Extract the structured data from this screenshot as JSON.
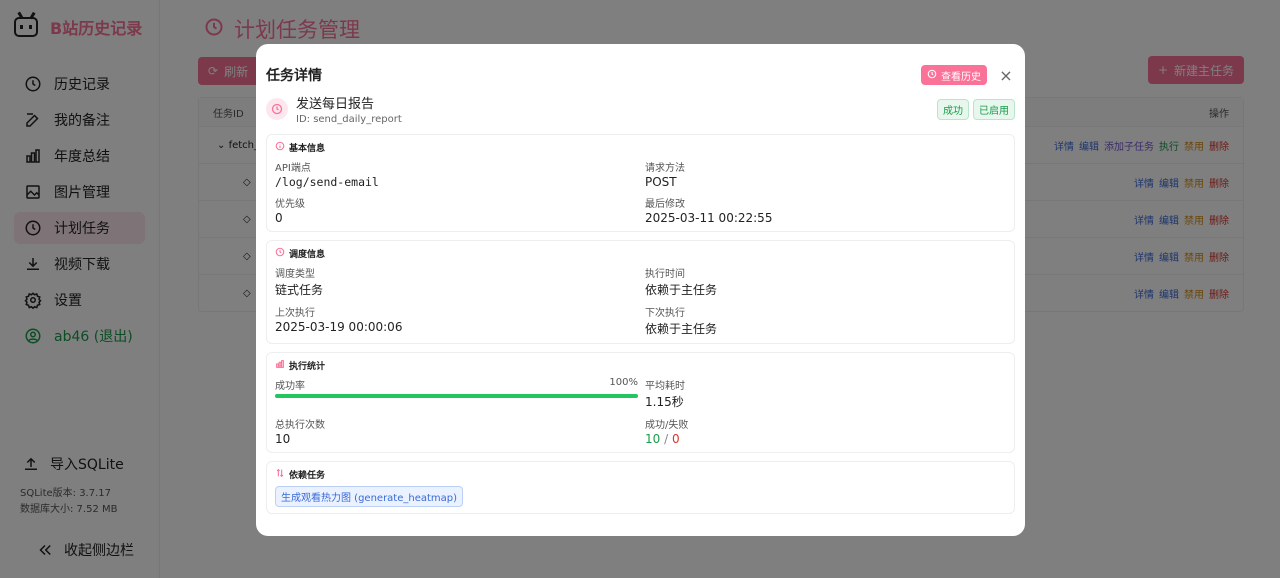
{
  "app": {
    "title": "B站历史记录"
  },
  "sidebar": {
    "items": [
      {
        "label": "历史记录",
        "icon": "clock-icon"
      },
      {
        "label": "我的备注",
        "icon": "edit-icon"
      },
      {
        "label": "年度总结",
        "icon": "bar-chart-icon"
      },
      {
        "label": "图片管理",
        "icon": "image-icon"
      },
      {
        "label": "计划任务",
        "icon": "clock-icon",
        "active": true
      },
      {
        "label": "视频下载",
        "icon": "download-icon"
      },
      {
        "label": "设置",
        "icon": "gear-icon"
      },
      {
        "label": "ab46 (退出)",
        "icon": "user-icon"
      }
    ],
    "import_label": "导入SQLite",
    "sqlite_version": "SQLite版本: 3.7.17",
    "db_size": "数据库大小: 7.52 MB",
    "collapse_label": "收起侧边栏"
  },
  "page": {
    "title": "计划任务管理",
    "refresh_label": "刷新",
    "new_task_label": "新建主任务",
    "table": {
      "col_id": "任务ID",
      "col_actions": "操作",
      "parent_row": {
        "id": "fetch_",
        "actions": [
          "详情",
          "编辑",
          "添加子任务",
          "执行",
          "禁用",
          "删除"
        ]
      },
      "child_actions": [
        "详情",
        "编辑",
        "禁用",
        "删除"
      ]
    }
  },
  "modal": {
    "title": "任务详情",
    "history_button": "查看历史",
    "close": "×",
    "task": {
      "name": "发送每日报告",
      "id_text": "ID: send_daily_report",
      "badge_status": "成功",
      "badge_enabled": "已启用"
    },
    "basic": {
      "title": "基本信息",
      "api_label": "API端点",
      "api_value": "/log/send-email",
      "method_label": "请求方法",
      "method_value": "POST",
      "priority_label": "优先级",
      "priority_value": "0",
      "modified_label": "最后修改",
      "modified_value": "2025-03-11 00:22:55"
    },
    "schedule": {
      "title": "调度信息",
      "type_label": "调度类型",
      "type_value": "链式任务",
      "time_label": "执行时间",
      "time_value": "依赖于主任务",
      "last_label": "上次执行",
      "last_value": "2025-03-19 00:00:06",
      "next_label": "下次执行",
      "next_value": "依赖于主任务"
    },
    "stats": {
      "title": "执行统计",
      "success_rate_label": "成功率",
      "success_rate_text": "100%",
      "success_rate": 1.0,
      "avg_label": "平均耗时",
      "avg_value": "1.15秒",
      "total_label": "总执行次数",
      "total_value": "10",
      "sf_label": "成功/失败",
      "success_count": "10",
      "sep": "/",
      "fail_count": "0"
    },
    "deps": {
      "title": "依赖任务",
      "items": [
        "生成观看热力图 (generate_heatmap)"
      ]
    }
  },
  "colors": {
    "accent": "#fb7299",
    "success": "#22c55e",
    "danger": "#d9342b",
    "link": "#3b6bd8"
  }
}
